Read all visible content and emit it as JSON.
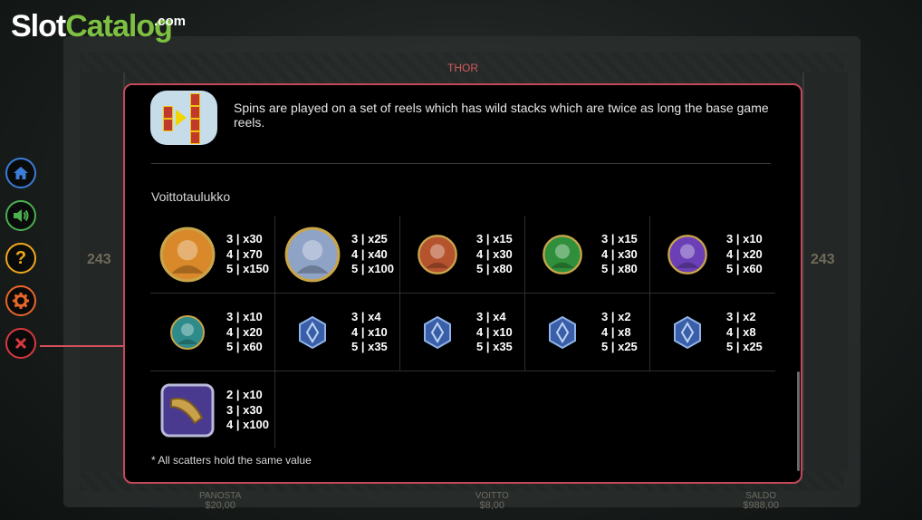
{
  "logo": {
    "slot": "Slot",
    "catalog": "Catalog",
    "com": ".com"
  },
  "game_title": "THOR",
  "background": {
    "ways_left": "243",
    "ways_right": "243",
    "bottom": [
      {
        "label": "PANOSTA",
        "value": "$20,00"
      },
      {
        "label": "VOITTO",
        "value": "$8,00"
      },
      {
        "label": "SALDO",
        "value": "$988,00"
      }
    ]
  },
  "sidebar": [
    {
      "name": "home",
      "icon": "home-icon",
      "color": "#3b7dd8"
    },
    {
      "name": "sound",
      "icon": "speaker-icon",
      "color": "#4caf50"
    },
    {
      "name": "help",
      "icon": "question-icon",
      "color": "#f0a81c"
    },
    {
      "name": "settings",
      "icon": "gear-icon",
      "color": "#e8662a"
    },
    {
      "name": "close",
      "icon": "close-icon",
      "color": "#d8383e"
    }
  ],
  "panel": {
    "feature_text": "Spins are played on a set of reels which has wild stacks which are twice as long the base game reels.",
    "section_title": "Voittotaulukko",
    "note": "* All scatters hold the same value",
    "paytable": [
      [
        {
          "icon": "thor-icon",
          "color": "#d9892a",
          "lines": [
            "3 | x30",
            "4 | x70",
            "5 | x150"
          ]
        },
        {
          "icon": "odin-icon",
          "color": "#8fa3c7",
          "lines": [
            "3 | x25",
            "4 | x40",
            "5 | x100"
          ]
        },
        {
          "icon": "freya-icon",
          "color": "#b5532f",
          "lines": [
            "3 | x15",
            "4 | x30",
            "5 | x80"
          ]
        },
        {
          "icon": "serpent-icon",
          "color": "#2f8f3a",
          "lines": [
            "3 | x15",
            "4 | x30",
            "5 | x80"
          ]
        },
        {
          "icon": "crystal-icon",
          "color": "#6b3fb5",
          "lines": [
            "3 | x10",
            "4 | x20",
            "5 | x60"
          ]
        }
      ],
      [
        {
          "icon": "throne-icon",
          "color": "#2f8a8a",
          "lines": [
            "3 | x10",
            "4 | x20",
            "5 | x60"
          ]
        },
        {
          "icon": "rune-a-icon",
          "color": "#3a5fa8",
          "lines": [
            "3 | x4",
            "4 | x10",
            "5 | x35"
          ]
        },
        {
          "icon": "rune-k-icon",
          "color": "#3a5fa8",
          "lines": [
            "3 | x4",
            "4 | x10",
            "5 | x35"
          ]
        },
        {
          "icon": "rune-q-icon",
          "color": "#3a5fa8",
          "lines": [
            "3 | x2",
            "4 | x8",
            "5 | x25"
          ]
        },
        {
          "icon": "rune-j-icon",
          "color": "#3a5fa8",
          "lines": [
            "3 | x2",
            "4 | x8",
            "5 | x25"
          ]
        }
      ],
      [
        {
          "icon": "horn-scatter-icon",
          "color": "#c8a14a",
          "lines": [
            "2 | x10",
            "3 | x30",
            "4 | x100"
          ]
        }
      ]
    ]
  }
}
